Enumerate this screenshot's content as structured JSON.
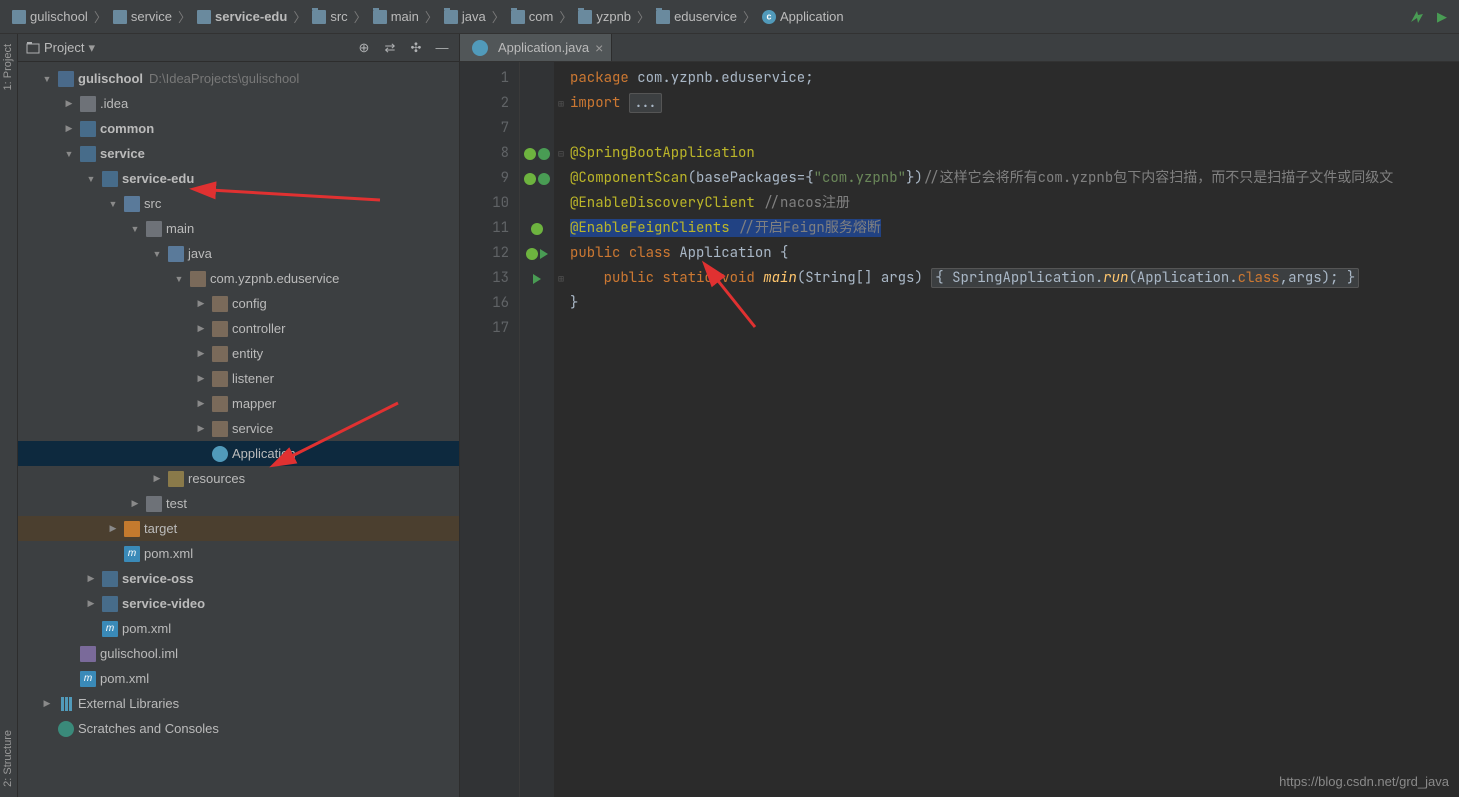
{
  "breadcrumb": [
    {
      "type": "project",
      "label": "gulischool"
    },
    {
      "type": "module",
      "label": "service"
    },
    {
      "type": "module",
      "label": "service-edu",
      "bold": true
    },
    {
      "type": "folder",
      "label": "src"
    },
    {
      "type": "folder",
      "label": "main"
    },
    {
      "type": "folder",
      "label": "java"
    },
    {
      "type": "folder",
      "label": "com"
    },
    {
      "type": "folder",
      "label": "yzpnb"
    },
    {
      "type": "folder",
      "label": "eduservice"
    },
    {
      "type": "class",
      "label": "Application"
    }
  ],
  "sidebar": {
    "title": "Project",
    "tree": [
      {
        "indent": 0,
        "arrow": "open",
        "icon": "proj",
        "label": "gulischool",
        "bold": true,
        "hint": "D:\\IdeaProjects\\gulischool"
      },
      {
        "indent": 1,
        "arrow": "closed",
        "icon": "dir",
        "label": ".idea"
      },
      {
        "indent": 1,
        "arrow": "closed",
        "icon": "mod",
        "label": "common",
        "bold": true
      },
      {
        "indent": 1,
        "arrow": "open",
        "icon": "mod",
        "label": "service",
        "bold": true
      },
      {
        "indent": 2,
        "arrow": "open",
        "icon": "mod",
        "label": "service-edu",
        "bold": true
      },
      {
        "indent": 3,
        "arrow": "open",
        "icon": "src",
        "label": "src"
      },
      {
        "indent": 4,
        "arrow": "open",
        "icon": "dir",
        "label": "main"
      },
      {
        "indent": 5,
        "arrow": "open",
        "icon": "java",
        "label": "java"
      },
      {
        "indent": 6,
        "arrow": "open",
        "icon": "pkg",
        "label": "com.yzpnb.eduservice"
      },
      {
        "indent": 7,
        "arrow": "closed",
        "icon": "pkg",
        "label": "config"
      },
      {
        "indent": 7,
        "arrow": "closed",
        "icon": "pkg",
        "label": "controller"
      },
      {
        "indent": 7,
        "arrow": "closed",
        "icon": "pkg",
        "label": "entity"
      },
      {
        "indent": 7,
        "arrow": "closed",
        "icon": "pkg",
        "label": "listener"
      },
      {
        "indent": 7,
        "arrow": "closed",
        "icon": "pkg",
        "label": "mapper"
      },
      {
        "indent": 7,
        "arrow": "closed",
        "icon": "pkg",
        "label": "service"
      },
      {
        "indent": 7,
        "arrow": "none",
        "icon": "class",
        "label": "Application",
        "selected": true
      },
      {
        "indent": 5,
        "arrow": "closed",
        "icon": "res",
        "label": "resources"
      },
      {
        "indent": 4,
        "arrow": "closed",
        "icon": "dir",
        "label": "test"
      },
      {
        "indent": 3,
        "arrow": "closed",
        "icon": "target",
        "label": "target",
        "target": true
      },
      {
        "indent": 3,
        "arrow": "none",
        "icon": "m",
        "label": "pom.xml"
      },
      {
        "indent": 2,
        "arrow": "closed",
        "icon": "mod",
        "label": "service-oss",
        "bold": true
      },
      {
        "indent": 2,
        "arrow": "closed",
        "icon": "mod",
        "label": "service-video",
        "bold": true
      },
      {
        "indent": 2,
        "arrow": "none",
        "icon": "m",
        "label": "pom.xml"
      },
      {
        "indent": 1,
        "arrow": "none",
        "icon": "iml",
        "label": "gulischool.iml"
      },
      {
        "indent": 1,
        "arrow": "none",
        "icon": "m",
        "label": "pom.xml"
      },
      {
        "indent": 0,
        "arrow": "closed",
        "icon": "lib",
        "label": "External Libraries"
      },
      {
        "indent": 0,
        "arrow": "none",
        "icon": "scratch",
        "label": "Scratches and Consoles"
      }
    ]
  },
  "left_tabs": [
    {
      "label": "1: Project"
    },
    {
      "label": "2: Structure"
    }
  ],
  "editor": {
    "tab_label": "Application.java",
    "lines": [
      {
        "n": 1,
        "html": "<span class='kw'>package</span> com.yzpnb.eduservice;"
      },
      {
        "n": 2,
        "html": "<span class='kw'>import</span> <span class='fold-box'>...</span>",
        "fold": "⊞"
      },
      {
        "n": 7,
        "html": ""
      },
      {
        "n": 8,
        "html": "<span class='annot'>@SpringBootApplication</span>",
        "icons": [
          "spring",
          "spring2"
        ],
        "fold": "⊟"
      },
      {
        "n": 9,
        "html": "<span class='annot'>@ComponentScan</span>(basePackages={<span class='str'>\"com.yzpnb\"</span>})<span class='comment'>//这样它会将所有com.yzpnb包下内容扫描，而不只是扫描子文件或同级文</span>",
        "icons": [
          "spring",
          "spring2"
        ]
      },
      {
        "n": 10,
        "html": "<span class='annot'>@</span><span class='annot'>EnableDiscoveryClient</span> <span class='comment'>//nacos注册</span>"
      },
      {
        "n": 11,
        "html": "<span class='sel'><span class='annot'>@EnableFeignClients</span> <span class='comment'>//开启Feign服务熔断</span></span>",
        "icons": [
          "spring"
        ]
      },
      {
        "n": 12,
        "html": "<span class='kw'>public</span> <span class='kw'>class</span> <span class='cls'>Application</span> {",
        "icons": [
          "spring",
          "run"
        ]
      },
      {
        "n": 13,
        "html": "    <span class='kw'>public</span> <span class='kw'>static</span> <span class='kw'>void</span> <span class='method'>main</span>(String[] args) <span class='fold-box'>{ SpringApplication.<span class='method'>run</span>(Application.<span class='kw'>class</span>,args); }</span>",
        "icons": [
          "run"
        ],
        "fold": "⊞"
      },
      {
        "n": 16,
        "html": "}"
      },
      {
        "n": 17,
        "html": ""
      }
    ]
  },
  "watermark": "https://blog.csdn.net/grd_java"
}
